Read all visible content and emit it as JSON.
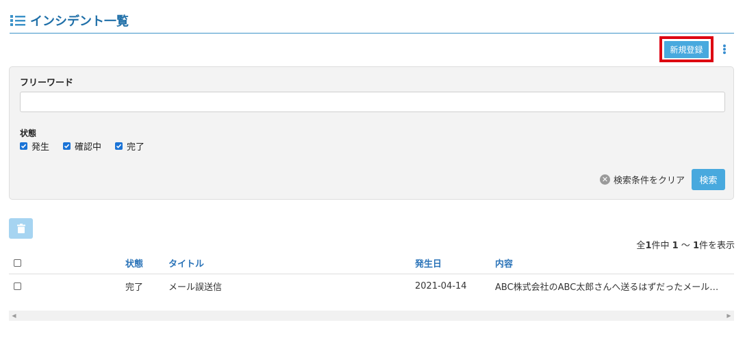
{
  "header": {
    "title": "インシデント一覧",
    "icon": "list-icon"
  },
  "toolbar": {
    "new_label": "新規登録",
    "menu_icon": "kebab-menu-icon"
  },
  "search": {
    "freeword_label": "フリーワード",
    "freeword_value": "",
    "status_label": "状態",
    "statuses": [
      {
        "label": "発生",
        "checked": true
      },
      {
        "label": "確認中",
        "checked": true
      },
      {
        "label": "完了",
        "checked": true
      }
    ],
    "clear_label": "検索条件をクリア",
    "search_label": "検索"
  },
  "list": {
    "delete_icon": "trash-icon",
    "count_prefix": "全",
    "count_total": "1",
    "count_middle": "件中 ",
    "count_from": "1",
    "count_sep": " 〜 ",
    "count_to": "1",
    "count_suffix": "件を表示",
    "columns": {
      "status": "状態",
      "title": "タイトル",
      "date": "発生日",
      "content": "内容"
    },
    "rows": [
      {
        "status": "完了",
        "title": "メール誤送信",
        "date": "2021-04-14",
        "content": "ABC株式会社のABC太郎さんへ送るはずだったメールが..."
      }
    ]
  },
  "colors": {
    "accent": "#48a9de",
    "title": "#1f6fa8",
    "highlight": "#dd0011"
  }
}
